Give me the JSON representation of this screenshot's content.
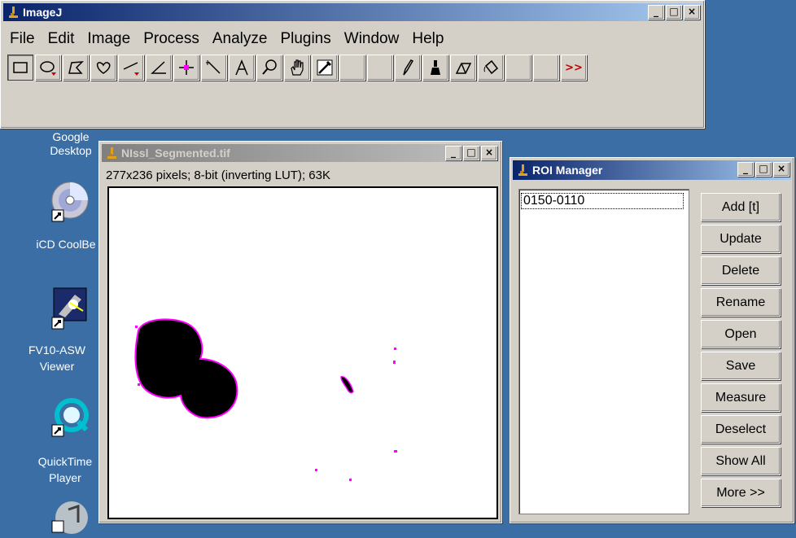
{
  "imagej": {
    "title": "ImageJ",
    "menu": [
      "File",
      "Edit",
      "Image",
      "Process",
      "Analyze",
      "Plugins",
      "Window",
      "Help"
    ],
    "tools": [
      "rectangle-tool",
      "oval-tool",
      "polygon-tool",
      "freehand-tool",
      "line-tool",
      "angle-tool",
      "point-tool",
      "wand-tool",
      "text-tool",
      "magnifier-tool",
      "hand-tool",
      "color-picker-tool",
      "",
      "",
      "pencil-tool",
      "brush-tool",
      "eraser-tool",
      "flood-fill-tool",
      "",
      ""
    ],
    "more_label": ">>"
  },
  "desktop_icons": [
    {
      "label_lines": [
        "Google",
        "Desktop"
      ]
    },
    {
      "label_lines": [
        "iCD CoolBe"
      ]
    },
    {
      "label_lines": [
        "FV10-ASW",
        "Viewer"
      ]
    },
    {
      "label_lines": [
        "QuickTime",
        "Player"
      ]
    }
  ],
  "image_window": {
    "title": "NIssl_Segmented.tif",
    "info": "277x236 pixels; 8-bit (inverting LUT); 63K"
  },
  "roi_manager": {
    "title": "ROI Manager",
    "list_items": [
      "0150-0110"
    ],
    "buttons": [
      "Add [t]",
      "Update",
      "Delete",
      "Rename",
      "Open",
      "Save",
      "Measure",
      "Deselect",
      "Show All",
      "More >>"
    ]
  },
  "colors": {
    "desktop": "#3a6ea5",
    "roi_outline": "#ff00ff",
    "active_title": "#0a246a"
  }
}
